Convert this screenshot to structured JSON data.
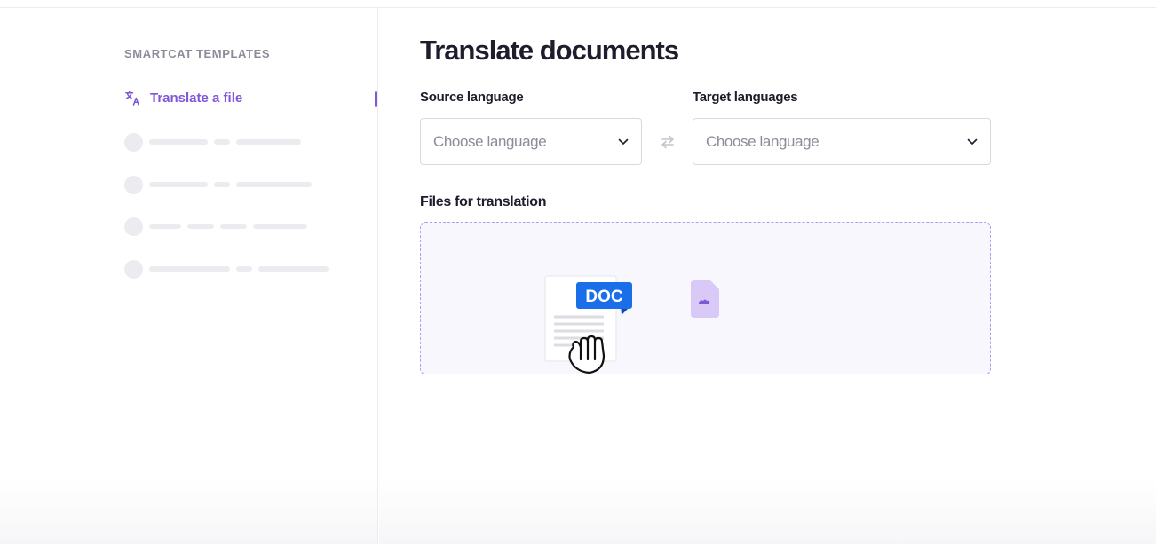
{
  "sidebar": {
    "heading": "SMARTCAT TEMPLATES",
    "active_item": {
      "label": "Translate a file",
      "icon": "translate-icon"
    }
  },
  "main": {
    "title": "Translate documents",
    "source": {
      "label": "Source language",
      "placeholder": "Choose language"
    },
    "target": {
      "label": "Target languages",
      "placeholder": "Choose language"
    },
    "files": {
      "label": "Files for translation",
      "doc_badge": "DOC"
    }
  },
  "colors": {
    "accent": "#7f57d9",
    "doc_blue": "#1a6ee8",
    "dropzone_border": "#b29cf0",
    "skeleton": "#ececf0"
  }
}
